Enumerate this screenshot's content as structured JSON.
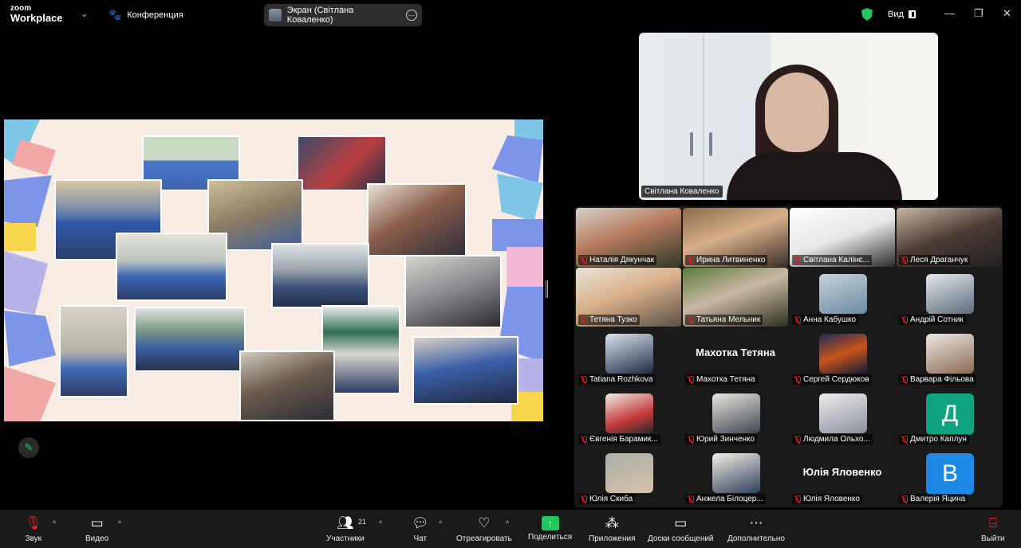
{
  "app": {
    "logo_top": "zoom",
    "logo_bottom": "Workplace",
    "meeting_name": "Конференция",
    "screen_share_label": "Экран (Світлана Коваленко)",
    "view_label": "Вид"
  },
  "speaker": {
    "name": "Світлана Коваленко"
  },
  "participants": [
    {
      "name": "Наталія Дякунчак",
      "type": "video"
    },
    {
      "name": "Ирина Литвиненко",
      "type": "video"
    },
    {
      "name": "Світлана Калінє...",
      "type": "video"
    },
    {
      "name": "Леся Драганчук",
      "type": "video"
    },
    {
      "name": "Тетяна Тузко",
      "type": "video"
    },
    {
      "name": "Татьяна Мельник",
      "type": "video"
    },
    {
      "name": "Анна Кабушко",
      "type": "avatar"
    },
    {
      "name": "Андрій Сотник",
      "type": "avatar"
    },
    {
      "name": "Tatiana Rozhkova",
      "type": "avatar"
    },
    {
      "name": "Махотка Тетяна",
      "type": "name",
      "display": "Махотка Тетяна"
    },
    {
      "name": "Сергей Сердюков",
      "type": "avatar"
    },
    {
      "name": "Варвара Фільова",
      "type": "avatar"
    },
    {
      "name": "Євгенія Барамик...",
      "type": "avatar"
    },
    {
      "name": "Юрий Зинченко",
      "type": "avatar"
    },
    {
      "name": "Людмила Ольхо...",
      "type": "avatar"
    },
    {
      "name": "Дмитро Каплун",
      "type": "letter",
      "letter": "Д",
      "color": "#10a37f"
    },
    {
      "name": "Юлія Скиба",
      "type": "avatar"
    },
    {
      "name": "Анжела Білоцер...",
      "type": "avatar"
    },
    {
      "name": "Юлія Яловенко",
      "type": "name",
      "display": "Юлія Яловенко"
    },
    {
      "name": "Валерія Яцина",
      "type": "letter",
      "letter": "В",
      "color": "#1e88e5"
    }
  ],
  "toolbar": {
    "audio": "Звук",
    "video": "Видео",
    "participants": "Участники",
    "participants_count": "21",
    "chat": "Чат",
    "react": "Отреагировать",
    "share": "Поделиться",
    "apps": "Приложения",
    "whiteboards": "Доски сообщений",
    "more": "Дополнительно",
    "leave": "Выйти"
  },
  "colors": {
    "accent_green": "#22c55e",
    "mute_red": "#e02424",
    "toolbar_bg": "#1a1a1a"
  }
}
